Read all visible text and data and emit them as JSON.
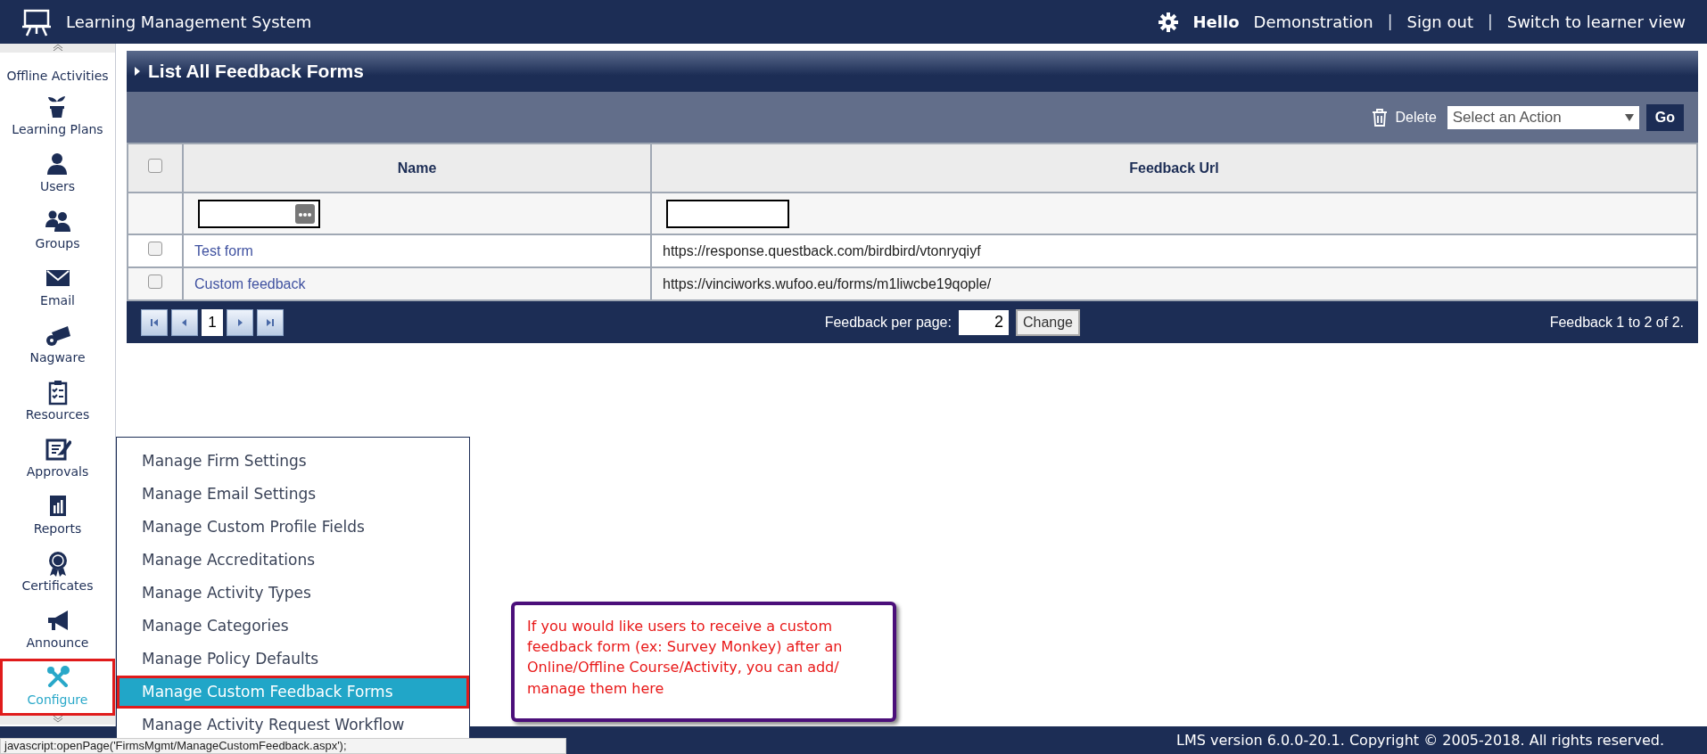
{
  "header": {
    "title": "Learning Management System",
    "greeting": "Hello",
    "nav": [
      {
        "kind": "link",
        "text": "Demonstration"
      },
      {
        "kind": "separator",
        "text": "|"
      },
      {
        "kind": "link",
        "text": "Sign out"
      },
      {
        "kind": "separator",
        "text": "|"
      },
      {
        "kind": "link",
        "text": "Switch to learner view"
      }
    ]
  },
  "sidebar": {
    "items": [
      {
        "label": "Offline Activities",
        "selected": false
      },
      {
        "label": "Learning Plans",
        "selected": false
      },
      {
        "label": "Users",
        "selected": false
      },
      {
        "label": "Groups",
        "selected": false
      },
      {
        "label": "Email",
        "selected": false
      },
      {
        "label": "Nagware",
        "selected": false
      },
      {
        "label": "Resources",
        "selected": false
      },
      {
        "label": "Approvals",
        "selected": false
      },
      {
        "label": "Reports",
        "selected": false
      },
      {
        "label": "Certificates",
        "selected": false
      },
      {
        "label": "Announce",
        "selected": false
      },
      {
        "label": "Configure",
        "selected": true
      }
    ]
  },
  "panel": {
    "title": "List All Feedback Forms",
    "toolbar": {
      "delete_label": "Delete",
      "action_select": "Select an Action",
      "go_button": "Go"
    },
    "table": {
      "columns": [
        "Name",
        "Feedback Url"
      ],
      "header_checked": false,
      "rows": [
        {
          "name": "Test form",
          "url": "https://response.questback.com/birdbird/vtonryqiyf",
          "checked": false
        },
        {
          "name": "Custom feedback",
          "url": "https://vinciworks.wufoo.eu/forms/m1liwcbe19qople/",
          "checked": false
        }
      ]
    },
    "pager": {
      "page": "1",
      "per_page_label": "Feedback per page:",
      "per_page": "2",
      "change_button": "Change",
      "summary": "Feedback 1 to 2 of 2."
    }
  },
  "menu": {
    "items": [
      {
        "label": "Manage Firm Settings",
        "selected": false
      },
      {
        "label": "Manage Email Settings",
        "selected": false
      },
      {
        "label": "Manage Custom Profile Fields",
        "selected": false
      },
      {
        "label": "Manage Accreditations",
        "selected": false
      },
      {
        "label": "Manage Activity Types",
        "selected": false
      },
      {
        "label": "Manage Categories",
        "selected": false
      },
      {
        "label": "Manage Policy Defaults",
        "selected": false
      },
      {
        "label": "Manage Custom Feedback Forms",
        "selected": true
      },
      {
        "label": "Manage Activity Request Workflow",
        "selected": false
      }
    ]
  },
  "callout": {
    "text": "If you would like users to receive a custom feedback form (ex: Survey Monkey) after an Online/Offline Course/Activity, you can add/ manage them here"
  },
  "footer": {
    "copyright": "LMS version 6.0.0-20.1. Copyright © 2005-2018. All rights reserved."
  },
  "status_bar": {
    "text": "javascript:openPage('FirmsMgmt/ManageCustomFeedback.aspx');"
  }
}
